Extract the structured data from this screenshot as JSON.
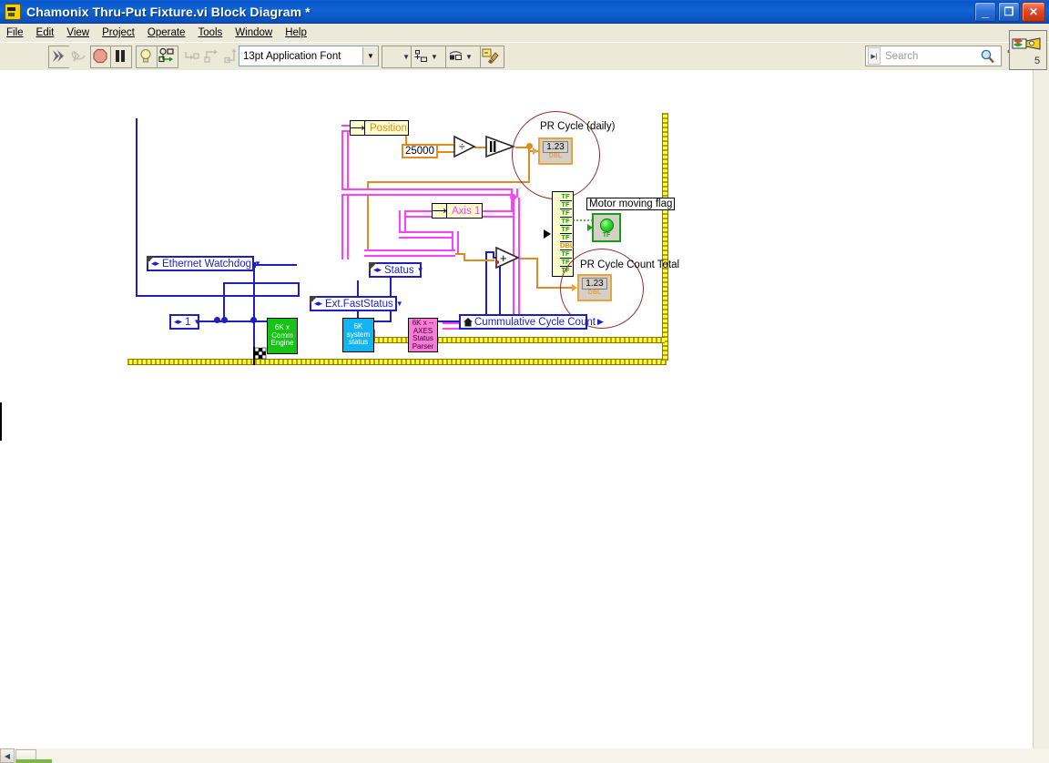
{
  "window": {
    "title": "Chamonix Thru-Put Fixture.vi Block Diagram *",
    "app_icon": "labview-vi-icon",
    "minimize_label": "_",
    "restore_label": "❐",
    "close_label": "✕"
  },
  "menu": {
    "items": [
      {
        "label": "File",
        "mnemonic": "F"
      },
      {
        "label": "Edit",
        "mnemonic": "E"
      },
      {
        "label": "View",
        "mnemonic": "V"
      },
      {
        "label": "Project",
        "mnemonic": "P"
      },
      {
        "label": "Operate",
        "mnemonic": "O"
      },
      {
        "label": "Tools",
        "mnemonic": "T"
      },
      {
        "label": "Window",
        "mnemonic": "W"
      },
      {
        "label": "Help",
        "mnemonic": "H"
      }
    ]
  },
  "toolbar": {
    "buttons": [
      {
        "name": "run-button",
        "icon": "run-arrow-icon",
        "enabled": true
      },
      {
        "name": "run-continuously-button",
        "icon": "run-continuous-icon",
        "enabled": false
      },
      {
        "name": "abort-button",
        "icon": "abort-stop-icon",
        "enabled": true
      },
      {
        "name": "pause-button",
        "icon": "pause-icon",
        "enabled": true
      },
      {
        "name": "highlight-execution-button",
        "icon": "lightbulb-icon",
        "enabled": true
      },
      {
        "name": "retain-wire-values-button",
        "icon": "retain-wire-values-icon",
        "enabled": true
      },
      {
        "name": "step-into-button",
        "icon": "step-into-icon",
        "enabled": false
      },
      {
        "name": "step-over-button",
        "icon": "step-over-icon",
        "enabled": false
      },
      {
        "name": "step-out-button",
        "icon": "step-out-icon",
        "enabled": false
      }
    ],
    "font_selector": {
      "value": "13pt Application Font",
      "arrow": "▼"
    },
    "align_objects": {
      "name": "align-objects-button",
      "arrow": "▼"
    },
    "distribute_objects": {
      "name": "distribute-objects-button",
      "arrow": "▼"
    },
    "reorder": {
      "name": "reorder-button",
      "arrow": "▼"
    },
    "clean_up_diagram": {
      "name": "clean-up-diagram-button"
    },
    "search": {
      "placeholder": "Search",
      "value": "",
      "icon": "magnifier-icon"
    },
    "help": {
      "icon": "question-mark-icon"
    },
    "context_help": {
      "icon": "context-help-window-icon",
      "badge": "5"
    }
  },
  "diagram": {
    "controls": [
      {
        "name": "ethernet-watchdog-enum",
        "label": "Ethernet Watchdog",
        "kind": "enum-ring",
        "arrow": "▼"
      },
      {
        "name": "axis-index-enum",
        "label": "1",
        "kind": "enum-ring",
        "arrow": "▼"
      },
      {
        "name": "status-enum",
        "label": "Status",
        "kind": "enum-ring",
        "arrow": "▼"
      },
      {
        "name": "ext-faststatus-enum",
        "label": "Ext.FastStatus",
        "kind": "enum-ring",
        "arrow": "▼"
      }
    ],
    "string_constants": [
      {
        "name": "position-string-constant",
        "value": "Position",
        "color": "#e08a22"
      },
      {
        "name": "axis-1-string-constant",
        "value": "Axis 1",
        "color": "#ff40ff"
      }
    ],
    "numeric_constants": [
      {
        "name": "counts-per-rev-constant",
        "value": "25000"
      }
    ],
    "functions": [
      {
        "name": "divide-function",
        "glyph": "÷"
      },
      {
        "name": "round-to-nearest-function",
        "glyph": "||"
      },
      {
        "name": "add-function",
        "glyph": "+"
      }
    ],
    "subvis": [
      {
        "name": "subvi-6k-comm-engine",
        "lines": [
          "6K x",
          "Comm",
          "Engine"
        ],
        "color": "#16c316"
      },
      {
        "name": "subvi-6k-system-status",
        "lines": [
          "6K",
          "system",
          "status"
        ],
        "color": "#13b5f0"
      },
      {
        "name": "subvi-6k-axes-status-parser",
        "lines": [
          "6K x --",
          "AXES",
          "Status",
          "Parser"
        ],
        "color": "#f97bd8"
      }
    ],
    "unbundle": {
      "name": "unbundle-by-name-cluster",
      "rows": [
        "TF",
        "TF",
        "TF",
        "TF",
        "TF",
        "TF",
        "DBL",
        "TF",
        "TF",
        "TF"
      ]
    },
    "indicators": [
      {
        "name": "pr-cycle-daily-indicator",
        "label": "PR Cycle (daily)",
        "value": "1.23",
        "type": "DBL"
      },
      {
        "name": "pr-cycle-count-total-indicator",
        "label": "PR Cycle Count Total",
        "value": "1.23",
        "type": "DBL"
      },
      {
        "name": "motor-moving-flag-indicator",
        "label": "Motor moving flag",
        "value": "TRUE",
        "type": "TF"
      }
    ],
    "local_variables": [
      {
        "name": "cummulative-cycle-count-local",
        "label": "Cummulative Cycle Count",
        "arrow": "▶"
      }
    ],
    "cursor": {
      "name": "run-flag-cursor",
      "icon": "checkered-flag-icon"
    }
  },
  "scrollbars": {
    "h_left_arrow": "◀",
    "h_right_arrow": "▶",
    "v_up_arrow": "▲",
    "v_down_arrow": "▼"
  },
  "colors": {
    "title_bar": "#0a55c8",
    "chrome": "#ece9d8",
    "wire_blue": "#1f1fbe",
    "wire_orange": "#e08a22",
    "wire_pink": "#ff40ff",
    "wire_error": "#ffff3a",
    "highlight_circle": "#9c2b2b",
    "canvas": "#ffffff"
  }
}
